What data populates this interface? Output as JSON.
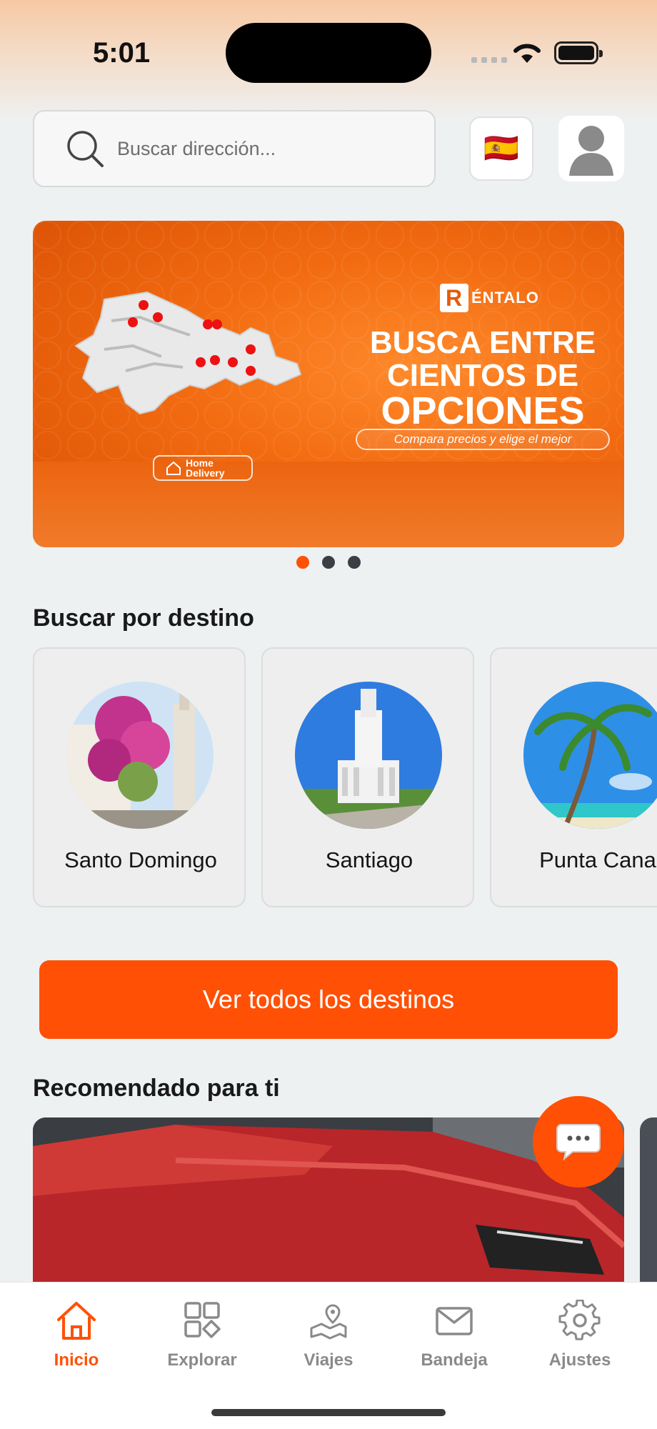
{
  "status_bar": {
    "time": "5:01"
  },
  "search": {
    "placeholder": "Buscar dirección..."
  },
  "language": {
    "flag": "🇪🇸"
  },
  "banner": {
    "brand": "ÉNTALO",
    "brand_letter": "R",
    "headline_line1": "BUSCA ENTRE",
    "headline_line2": "CIENTOS DE",
    "headline_line3": "OPCIONES",
    "subtitle": "Compara precios y elige el mejor",
    "chip_line1": "Home",
    "chip_line2": "Delivery",
    "active_slide": 1,
    "slide_count": 3
  },
  "destinations": {
    "title": "Buscar por destino",
    "items": [
      {
        "name": "Santo Domingo"
      },
      {
        "name": "Santiago"
      },
      {
        "name": "Punta Cana"
      }
    ],
    "cta_label": "Ver todos los destinos"
  },
  "recommended": {
    "title": "Recomendado para ti"
  },
  "tabbar": {
    "items": [
      {
        "label": "Inicio",
        "icon": "home-icon",
        "active": true
      },
      {
        "label": "Explorar",
        "icon": "grid-icon",
        "active": false
      },
      {
        "label": "Viajes",
        "icon": "map-icon",
        "active": false
      },
      {
        "label": "Bandeja",
        "icon": "mail-icon",
        "active": false
      },
      {
        "label": "Ajustes",
        "icon": "gear-icon",
        "active": false
      }
    ]
  },
  "colors": {
    "accent": "#ff5105",
    "tab_inactive": "#8a8a8a",
    "background": "#eef1f2"
  }
}
